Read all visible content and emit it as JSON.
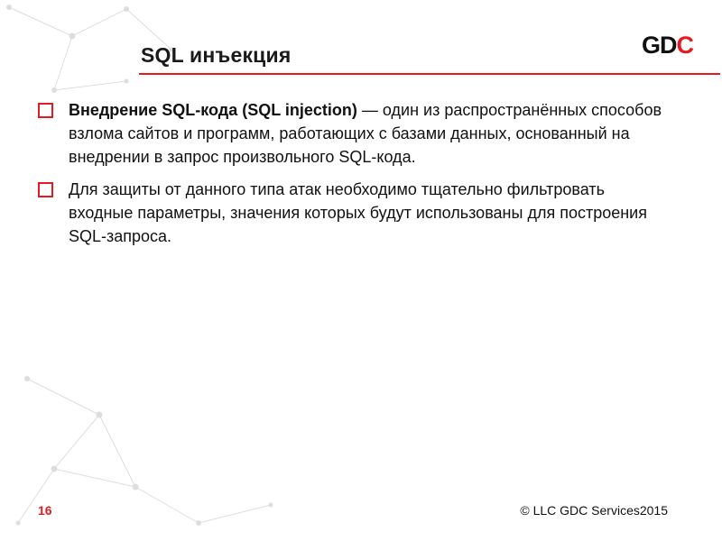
{
  "header": {
    "title": "SQL инъекция",
    "logo": {
      "g": "G",
      "d": "D",
      "c": "C"
    }
  },
  "bullets": [
    {
      "bold": "Внедрение SQL-кода (SQL injection)",
      "rest": " — один из распространённых способов взлома сайтов и программ, работающих с базами данных, основанный на внедрении в запрос произвольного SQL-кода."
    },
    {
      "bold": "",
      "rest": "Для защиты от данного типа атак необходимо тщательно фильтровать входные параметры, значения которых будут использованы для построения SQL-запроса."
    }
  ],
  "footer": {
    "page": "16",
    "copyright": "© LLC GDC Services2015"
  }
}
